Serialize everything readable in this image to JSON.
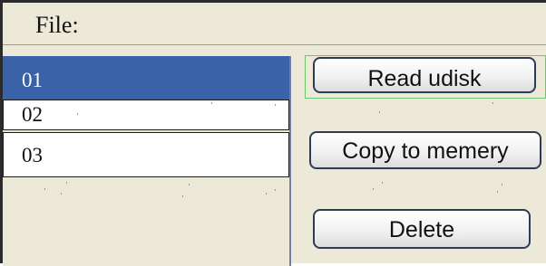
{
  "header": {
    "label": "File:"
  },
  "file_list": {
    "items": [
      {
        "label": "01",
        "selected": true
      },
      {
        "label": "02",
        "selected": false
      },
      {
        "label": "03",
        "selected": false
      }
    ]
  },
  "actions": {
    "read_label": "Read udisk",
    "copy_label": "Copy to memery",
    "delete_label": "Delete"
  },
  "colors": {
    "selection": "#3a62a8",
    "panel_bg": "#ece9d8",
    "focus_outline": "#6fc46f"
  }
}
